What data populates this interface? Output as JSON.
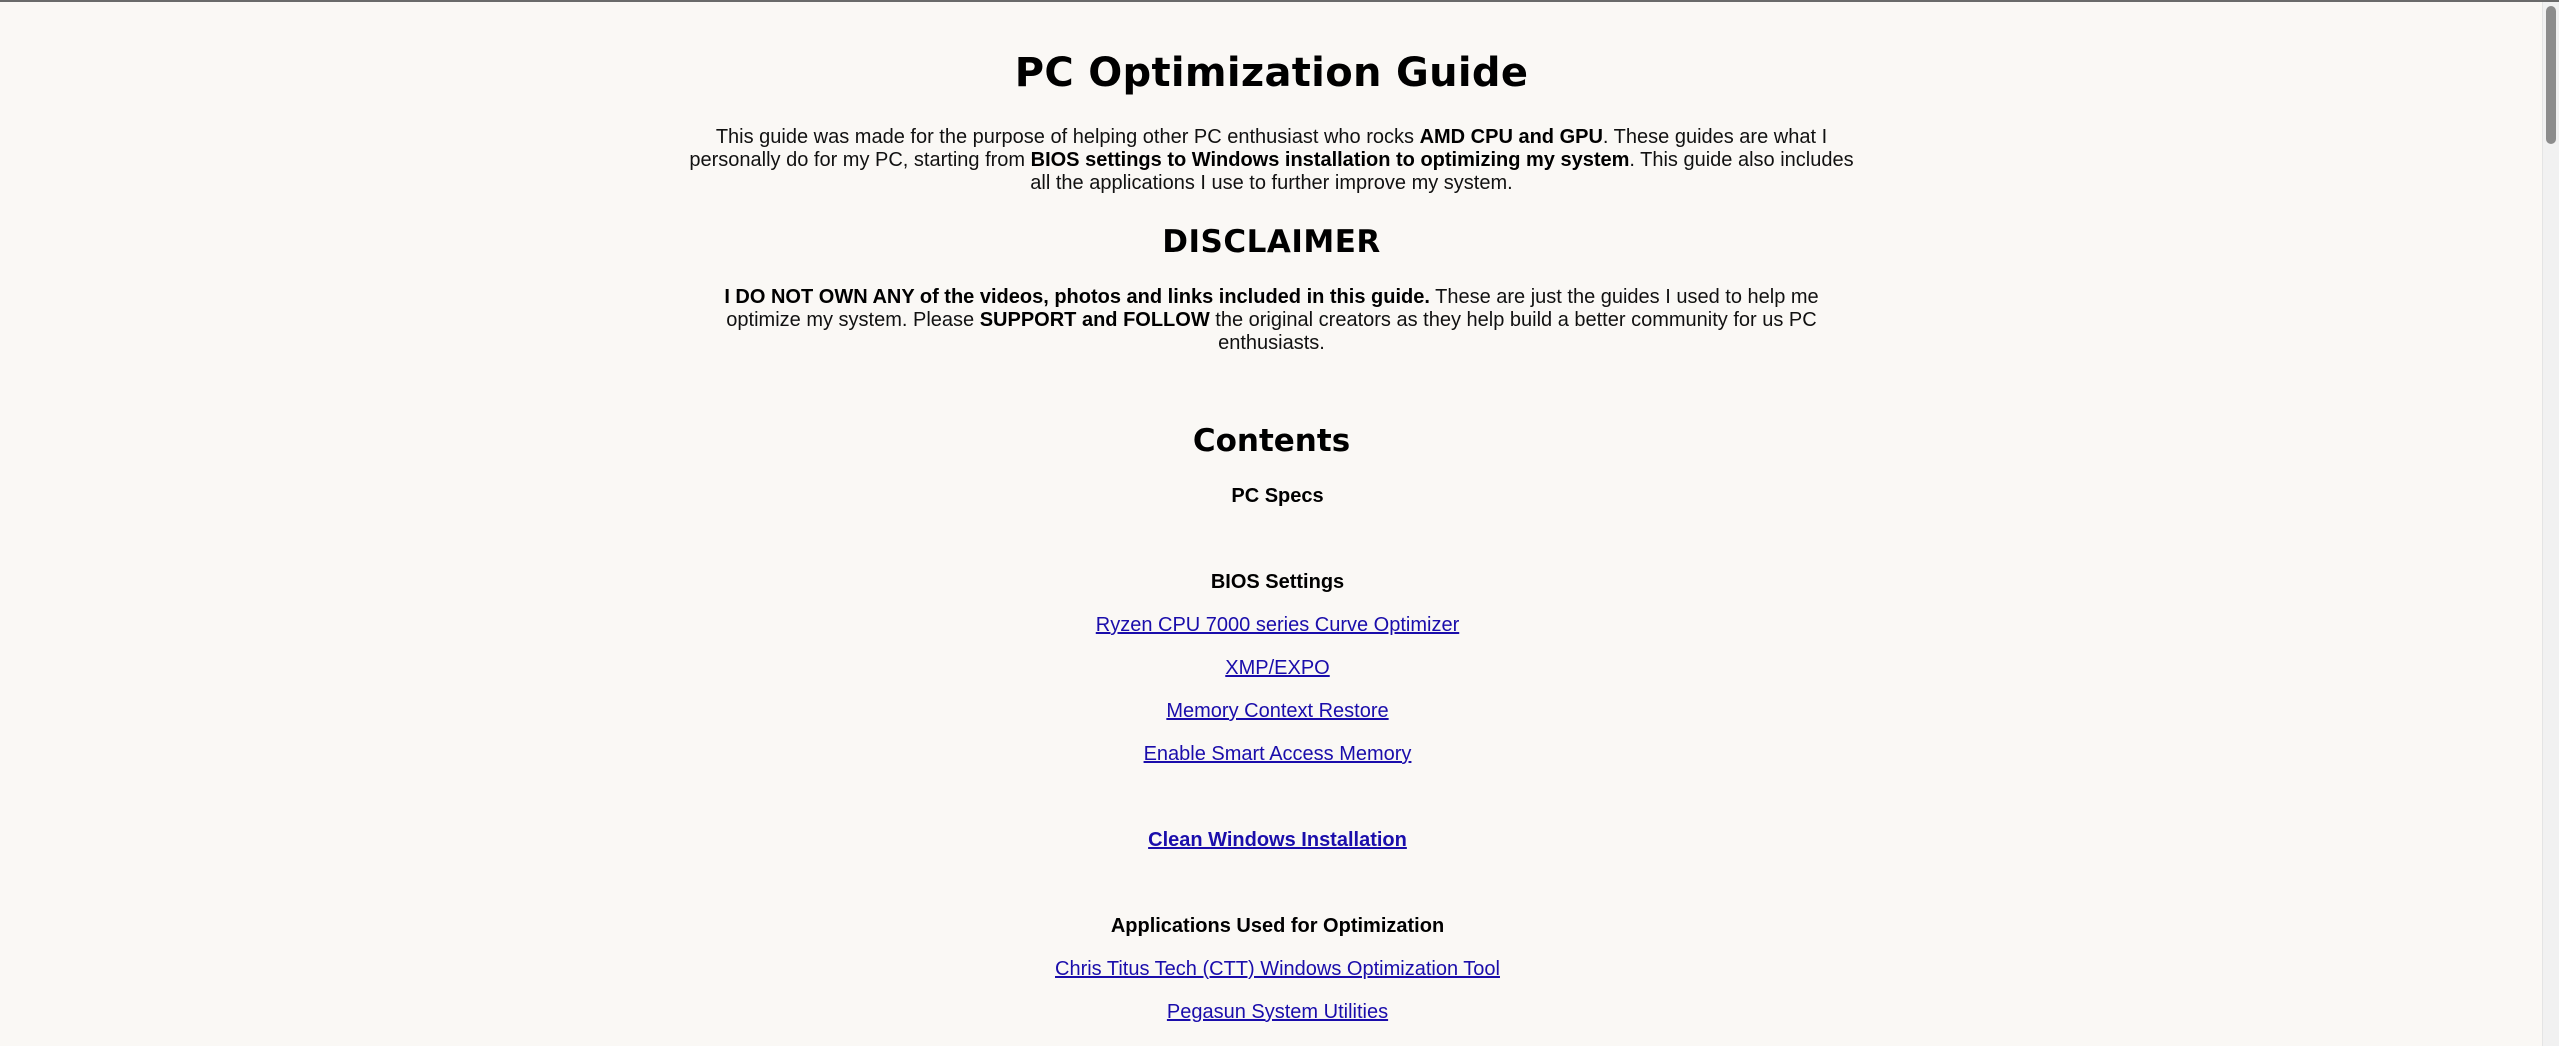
{
  "title": "PC Optimization Guide",
  "intro": {
    "part1": "This guide was made for the purpose of helping other PC enthusiast who rocks ",
    "bold1": "AMD CPU and GPU",
    "part2": ". These guides are what I personally do for my PC, starting from ",
    "bold2": "BIOS settings to Windows installation to optimizing my system",
    "part3": ". This guide also includes all the applications I use to further improve my system."
  },
  "disclaimer": {
    "heading": "DISCLAIMER",
    "bold1": "I DO NOT OWN ANY of the videos, photos and links included in this guide.",
    "part1": " These are just the guides I used to help me optimize my system. Please ",
    "bold2": "SUPPORT and FOLLOW",
    "part2": " the original creators as they help build a better community for us PC enthusiasts."
  },
  "contents": {
    "heading": "Contents",
    "pc_specs": "PC Specs",
    "bios_heading": "BIOS Settings",
    "bios_links": [
      "Ryzen CPU 7000 series Curve Optimizer",
      "XMP/EXPO",
      "Memory Context Restore",
      "Enable Smart Access Memory"
    ],
    "clean_windows": "Clean Windows Installation",
    "apps_heading": "Applications Used for Optimization",
    "app_links": [
      "Chris Titus Tech (CTT) Windows Optimization Tool",
      "Pegasun System Utilities"
    ]
  }
}
